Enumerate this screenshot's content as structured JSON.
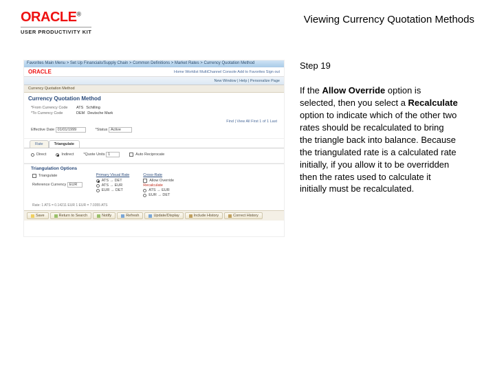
{
  "header": {
    "brand": "ORACLE",
    "brand_suffix": "®",
    "product": "USER PRODUCTIVITY KIT",
    "title": "Viewing Currency Quotation Methods"
  },
  "instruction": {
    "step_label": "Step 19",
    "text_before": "If the ",
    "bold1": "Allow Override",
    "text_mid1": " option is selected, then you select a ",
    "bold2": "Recalculate",
    "text_after": " option to indicate which of the other two rates should be recalculated to bring the triangle back into balance. Because the triangulated rate is a calculated rate initially, if you allow it to be overridden then the rates used to calculate it initially must be recalculated."
  },
  "mock": {
    "topbar": "Favorites     Main Menu  >  Set Up Financials/Supply Chain  >  Common Definitions  >  Market Rates  >  Currency Quotation Method",
    "mini_links": "Home    Worklist    MultiChannel Console    Add to Favorites    Sign out",
    "subrow": "New Window | Help | Personalize Page",
    "crumb": "Currency Quotation Method",
    "section_title": "Currency Quotation Method",
    "from_lbl": "*From Currency Code",
    "from_val": "ATS",
    "from_name": "Schilling",
    "to_lbl": "*To Currency Code",
    "to_val": "DEM",
    "to_name": "Deutsche Mark",
    "find_row": "Find | View All    First  1 of 1  Last",
    "eff_lbl": "Effective Date",
    "eff_val": "01/01/1999",
    "status_lbl": "*Status",
    "status_val": "Active",
    "tabs": {
      "rate": "Rate",
      "triang": "Triangulate"
    },
    "direct_lbl": "Direct",
    "indirect_lbl": "Indirect",
    "quote_units": "*Quote Units",
    "quote_val": "1",
    "auto_rec": "Auto Reciprocate",
    "group_title": "Triangulation Options",
    "ref_lbl": "Reference Currency",
    "ref_val": "EUR",
    "tri_label": "Triangulate",
    "pvr_header": "Primary Visual Rate",
    "pvr1": "ATS → DET",
    "pvr2": "ATS → EUR",
    "pvr3": "EUR → DET",
    "cr_header": "Cross-Rate",
    "cr_allow": "Allow Override",
    "cr_recalc": "Recalculate",
    "cr_opt1": "ATS → EUR",
    "cr_opt2": "EUR → DET",
    "rate_sample": "Rate: 1 ATS = 0.14211 EUR   1 EUR = 7.0355 ATS",
    "buttons": {
      "save": "Save",
      "back": "Return to Search",
      "notify": "Notify",
      "refresh": "Refresh",
      "update": "Update/Display",
      "history": "Include History",
      "correct": "Correct History"
    }
  }
}
